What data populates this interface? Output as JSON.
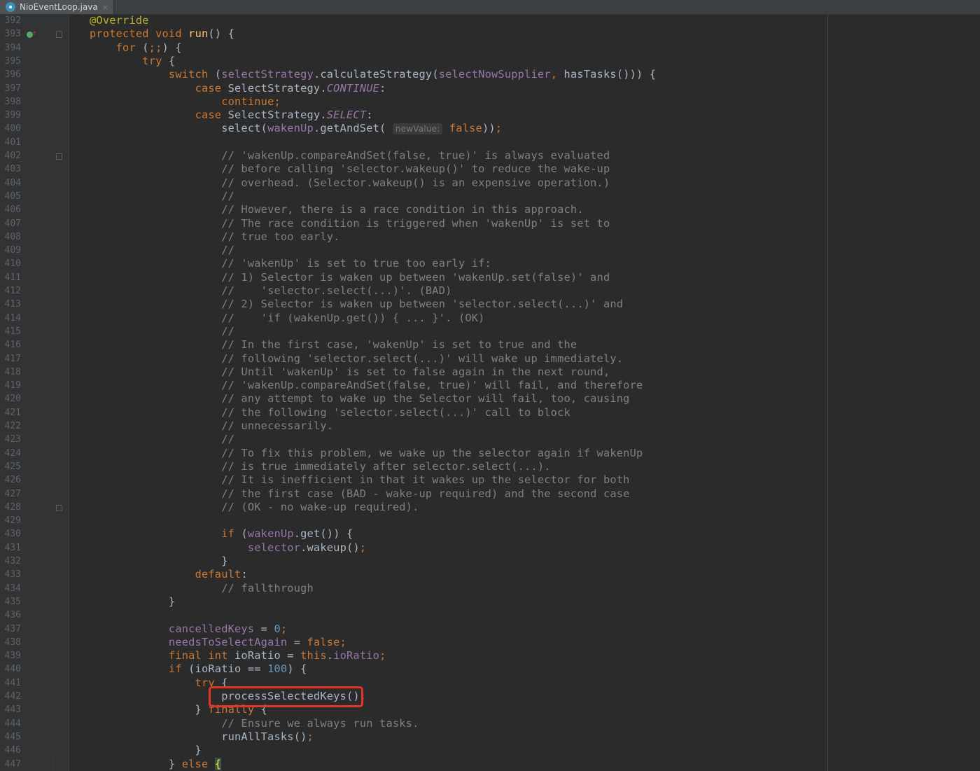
{
  "tab": {
    "filename": "NioEventLoop.java",
    "close_glyph": "×"
  },
  "hint": {
    "label": "newValue:"
  },
  "lines": [
    {
      "n": "392",
      "html": "<span class='ann'>@Override</span>"
    },
    {
      "n": "393",
      "html": "<span class='kw'>protected void</span> <span class='fn'>run</span>() {"
    },
    {
      "n": "394",
      "html": "    <span class='kw'>for</span> (<span class='kw'>;;</span>) {"
    },
    {
      "n": "395",
      "html": "        <span class='kw'>try</span> {"
    },
    {
      "n": "396",
      "html": "            <span class='kw'>switch</span> (<span class='field'>selectStrategy</span>.calculateStrategy(<span class='field'>selectNowSupplier</span><span class='kw'>,</span> hasTasks())) {"
    },
    {
      "n": "397",
      "html": "                <span class='kw'>case</span> SelectStrategy.<span class='const'>CONTINUE</span>:"
    },
    {
      "n": "398",
      "html": "                    <span class='kw'>continue;</span>"
    },
    {
      "n": "399",
      "html": "                <span class='kw'>case</span> SelectStrategy.<span class='const'>SELECT</span>:"
    },
    {
      "n": "400",
      "html": "                    select(<span class='field'>wakenUp</span>.getAndSet( <span class='hint' data-name='param-hint'>newValue:</span> <span class='kw'>false</span>))<span class='kw'>;</span>"
    },
    {
      "n": "401",
      "html": ""
    },
    {
      "n": "402",
      "html": "                    <span class='cmt'>// 'wakenUp.compareAndSet(false, true)' is always evaluated</span>"
    },
    {
      "n": "403",
      "html": "                    <span class='cmt'>// before calling 'selector.wakeup()' to reduce the wake-up</span>"
    },
    {
      "n": "404",
      "html": "                    <span class='cmt'>// overhead. (Selector.wakeup() is an expensive operation.)</span>"
    },
    {
      "n": "405",
      "html": "                    <span class='cmt'>//</span>"
    },
    {
      "n": "406",
      "html": "                    <span class='cmt'>// However, there is a race condition in this approach.</span>"
    },
    {
      "n": "407",
      "html": "                    <span class='cmt'>// The race condition is triggered when 'wakenUp' is set to</span>"
    },
    {
      "n": "408",
      "html": "                    <span class='cmt'>// true too early.</span>"
    },
    {
      "n": "409",
      "html": "                    <span class='cmt'>//</span>"
    },
    {
      "n": "410",
      "html": "                    <span class='cmt'>// 'wakenUp' is set to true too early if:</span>"
    },
    {
      "n": "411",
      "html": "                    <span class='cmt'>// 1) Selector is waken up between 'wakenUp.set(false)' and</span>"
    },
    {
      "n": "412",
      "html": "                    <span class='cmt'>//    'selector.select(...)'. (BAD)</span>"
    },
    {
      "n": "413",
      "html": "                    <span class='cmt'>// 2) Selector is waken up between 'selector.select(...)' and</span>"
    },
    {
      "n": "414",
      "html": "                    <span class='cmt'>//    'if (wakenUp.get()) { ... }'. (OK)</span>"
    },
    {
      "n": "415",
      "html": "                    <span class='cmt'>//</span>"
    },
    {
      "n": "416",
      "html": "                    <span class='cmt'>// In the first case, 'wakenUp' is set to true and the</span>"
    },
    {
      "n": "417",
      "html": "                    <span class='cmt'>// following 'selector.select(...)' will wake up immediately.</span>"
    },
    {
      "n": "418",
      "html": "                    <span class='cmt'>// Until 'wakenUp' is set to false again in the next round,</span>"
    },
    {
      "n": "419",
      "html": "                    <span class='cmt'>// 'wakenUp.compareAndSet(false, true)' will fail, and therefore</span>"
    },
    {
      "n": "420",
      "html": "                    <span class='cmt'>// any attempt to wake up the Selector will fail, too, causing</span>"
    },
    {
      "n": "421",
      "html": "                    <span class='cmt'>// the following 'selector.select(...)' call to block</span>"
    },
    {
      "n": "422",
      "html": "                    <span class='cmt'>// unnecessarily.</span>"
    },
    {
      "n": "423",
      "html": "                    <span class='cmt'>//</span>"
    },
    {
      "n": "424",
      "html": "                    <span class='cmt'>// To fix this problem, we wake up the selector again if wakenUp</span>"
    },
    {
      "n": "425",
      "html": "                    <span class='cmt'>// is true immediately after selector.select(...).</span>"
    },
    {
      "n": "426",
      "html": "                    <span class='cmt'>// It is inefficient in that it wakes up the selector for both</span>"
    },
    {
      "n": "427",
      "html": "                    <span class='cmt'>// the first case (BAD - wake-up required) and the second case</span>"
    },
    {
      "n": "428",
      "html": "                    <span class='cmt'>// (OK - no wake-up required).</span>"
    },
    {
      "n": "429",
      "html": ""
    },
    {
      "n": "430",
      "html": "                    <span class='kw'>if</span> (<span class='field'>wakenUp</span>.get()) {"
    },
    {
      "n": "431",
      "html": "                        <span class='field'>selector</span>.wakeup()<span class='kw'>;</span>"
    },
    {
      "n": "432",
      "html": "                    }"
    },
    {
      "n": "433",
      "html": "                <span class='kw'>default</span>:"
    },
    {
      "n": "434",
      "html": "                    <span class='cmt'>// fallthrough</span>"
    },
    {
      "n": "435",
      "html": "            }"
    },
    {
      "n": "436",
      "html": ""
    },
    {
      "n": "437",
      "html": "            <span class='field'>cancelledKeys</span> = <span class='num'>0</span><span class='kw'>;</span>"
    },
    {
      "n": "438",
      "html": "            <span class='field'>needsToSelectAgain</span> = <span class='kw'>false;</span>"
    },
    {
      "n": "439",
      "html": "            <span class='kw'>final int</span> ioRatio = <span class='kw'>this</span>.<span class='field'>ioRatio</span><span class='kw'>;</span>"
    },
    {
      "n": "440",
      "html": "            <span class='kw'>if</span> (ioRatio == <span class='num'>100</span>) {"
    },
    {
      "n": "441",
      "html": "                <span class='kw'>try</span> {"
    },
    {
      "n": "442",
      "html": "                    processSelectedKeys()<span class='kw'>;</span>"
    },
    {
      "n": "443",
      "html": "                } <span class='kw'>finally</span> {"
    },
    {
      "n": "444",
      "html": "                    <span class='cmt'>// Ensure we always run tasks.</span>"
    },
    {
      "n": "445",
      "html": "                    runAllTasks()<span class='kw'>;</span>"
    },
    {
      "n": "446",
      "html": "                }"
    },
    {
      "n": "447",
      "html": "            } <span class='kw'>else</span> <span class='bracket-hl'>{</span>"
    }
  ]
}
